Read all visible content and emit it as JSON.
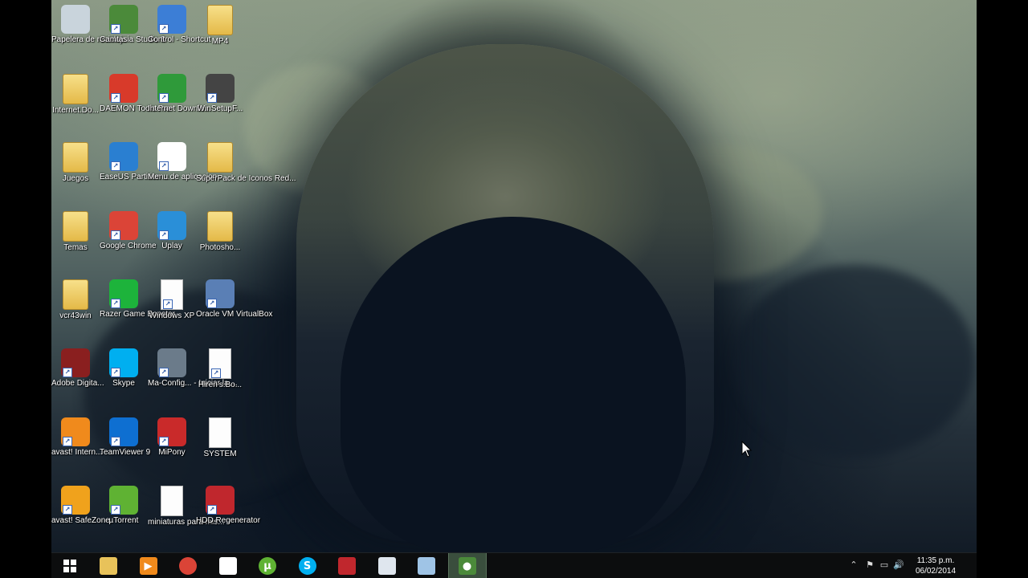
{
  "desktop": {
    "icons": [
      {
        "label": "Papelera de reciclaje",
        "icon": "recycle-bin-icon",
        "color": "#c9d4dc"
      },
      {
        "label": "Camtasia Studio 8",
        "icon": "camtasia-icon",
        "color": "#4b8a3a"
      },
      {
        "label": "Control - Shortcut",
        "icon": "control-panel-icon",
        "color": "#3c7ed6"
      },
      {
        "label": "MP4",
        "icon": "folder-icon",
        "color": "#e8c25a"
      },
      {
        "label": "Internet.Do...",
        "icon": "folder-icon",
        "color": "#e8c25a"
      },
      {
        "label": "DAEMON Tools Pro",
        "icon": "daemon-tools-icon",
        "color": "#d83a2a"
      },
      {
        "label": "Internet Downlo...",
        "icon": "idm-icon",
        "color": "#2f9a3a"
      },
      {
        "label": "WinSetupF...",
        "icon": "usb-drive-icon",
        "color": "#444444"
      },
      {
        "label": "Juegos",
        "icon": "folder-icon",
        "color": "#e8c25a"
      },
      {
        "label": "EaseUS Partition ...",
        "icon": "easeus-icon",
        "color": "#2a7fd1"
      },
      {
        "label": "Menu de aplicacion...",
        "icon": "app-menu-icon",
        "color": "#ffffff"
      },
      {
        "label": "SuperPack de Iconos Red...",
        "icon": "folder-chrome-icon",
        "color": "#e8c25a"
      },
      {
        "label": "Temas",
        "icon": "folder-icon",
        "color": "#e8c25a"
      },
      {
        "label": "Google Chrome",
        "icon": "chrome-icon",
        "color": "#db4437"
      },
      {
        "label": "Uplay",
        "icon": "uplay-icon",
        "color": "#2a8fd8"
      },
      {
        "label": "Photosho...",
        "icon": "folder-icon",
        "color": "#e8c25a"
      },
      {
        "label": "vcr43win",
        "icon": "folder-icon",
        "color": "#e8c25a"
      },
      {
        "label": "Razer Game Booster",
        "icon": "razer-icon",
        "color": "#1db33b"
      },
      {
        "label": "Windows XP",
        "icon": "iso-file-icon",
        "color": "#ffffff"
      },
      {
        "label": "Oracle VM VirtualBox",
        "icon": "virtualbox-icon",
        "color": "#5a7fb5"
      },
      {
        "label": "Adobe Digita...",
        "icon": "adobe-digital-icon",
        "color": "#8a1f1f"
      },
      {
        "label": "Skype",
        "icon": "skype-icon",
        "color": "#00aff0"
      },
      {
        "label": "Ma-Config... - Iniciar la ...",
        "icon": "ma-config-icon",
        "color": "#6b7b8a"
      },
      {
        "label": "Hiren's.Bo...",
        "icon": "iso-file-icon",
        "color": "#ffffff"
      },
      {
        "label": "avast! Intern...",
        "icon": "avast-icon",
        "color": "#f08a1c"
      },
      {
        "label": "TeamViewer 9",
        "icon": "teamviewer-icon",
        "color": "#0e6fd1"
      },
      {
        "label": "MiPony",
        "icon": "mipony-icon",
        "color": "#c92a2a"
      },
      {
        "label": "SYSTEM",
        "icon": "blank-file-icon",
        "color": "#ffffff"
      },
      {
        "label": "avast! SafeZone",
        "icon": "safezone-icon",
        "color": "#f0a21c"
      },
      {
        "label": "µTorrent",
        "icon": "utorrent-icon",
        "color": "#5fb233"
      },
      {
        "label": "miniaturas para mis...",
        "icon": "blank-file-icon",
        "color": "#ffffff"
      },
      {
        "label": "HDD Regenerator",
        "icon": "hdd-regenerator-icon",
        "color": "#c0272d"
      }
    ]
  },
  "taskbar": {
    "start": {
      "icon": "windows-start-icon"
    },
    "pinned": [
      {
        "icon": "file-explorer-icon",
        "color": "#e8c25a",
        "glyph": ""
      },
      {
        "icon": "media-player-icon",
        "color": "#f08a1c",
        "glyph": "▶"
      },
      {
        "icon": "chrome-icon",
        "color": "#db4437",
        "glyph": ""
      },
      {
        "icon": "app-menu-icon",
        "color": "#ffffff",
        "glyph": ""
      },
      {
        "icon": "utorrent-icon",
        "color": "#5fb233",
        "glyph": "µ"
      },
      {
        "icon": "skype-icon",
        "color": "#00aff0",
        "glyph": "S"
      },
      {
        "icon": "hdd-regenerator-icon",
        "color": "#c0272d",
        "glyph": ""
      },
      {
        "icon": "window-app-icon",
        "color": "#dfe6ee",
        "glyph": ""
      },
      {
        "icon": "notepad-icon",
        "color": "#9fc4e6",
        "glyph": ""
      },
      {
        "icon": "camtasia-recorder-icon",
        "color": "#4b8a3a",
        "glyph": "●",
        "active": true
      }
    ],
    "tray": {
      "icons": [
        "chevron-up-icon",
        "action-center-flag-icon",
        "network-icon",
        "volume-icon"
      ],
      "time": "11:35 p.m.",
      "date": "06/02/2014"
    }
  }
}
